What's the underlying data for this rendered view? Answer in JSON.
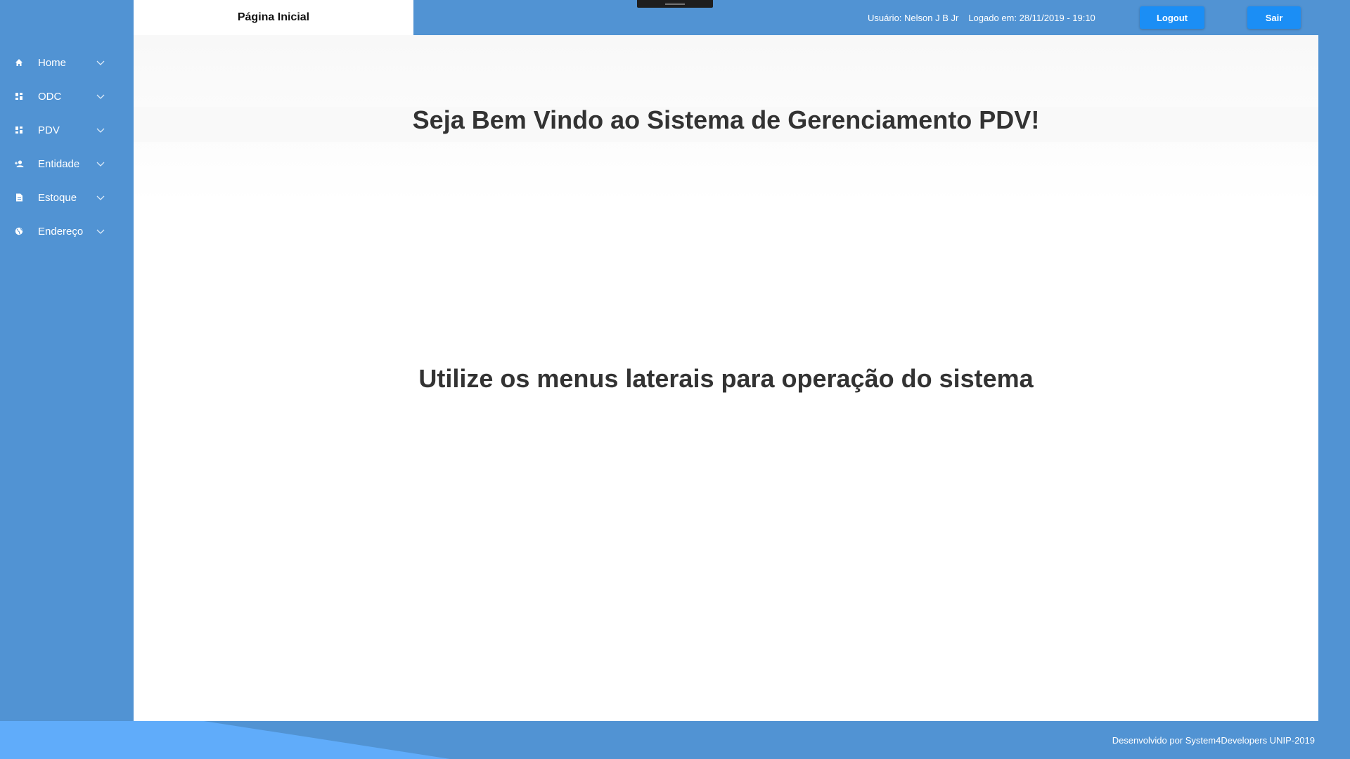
{
  "sidebar": {
    "items": [
      {
        "label": "Home",
        "icon": "home-icon"
      },
      {
        "label": "ODC",
        "icon": "dashboard-icon"
      },
      {
        "label": "PDV",
        "icon": "dashboard-icon"
      },
      {
        "label": "Entidade",
        "icon": "user-add-icon"
      },
      {
        "label": "Estoque",
        "icon": "document-icon"
      },
      {
        "label": "Endereço",
        "icon": "globe-icon"
      }
    ]
  },
  "header": {
    "active_tab": "Página Inicial",
    "user_label": "Usuário: Nelson J B Jr",
    "login_label": "Logado em: 28/11/2019 - 19:10",
    "logout_label": "Logout",
    "exit_label": "Sair"
  },
  "main": {
    "welcome": "Seja Bem Vindo ao Sistema de Gerenciamento PDV!",
    "instruction": "Utilize os menus laterais para operação do sistema"
  },
  "footer": {
    "credit": "Desenvolvido por System4Developers UNIP-2019"
  },
  "colors": {
    "background": "#5193d3",
    "button": "#1b8ef5",
    "panel": "#ffffff",
    "text": "#333333"
  }
}
